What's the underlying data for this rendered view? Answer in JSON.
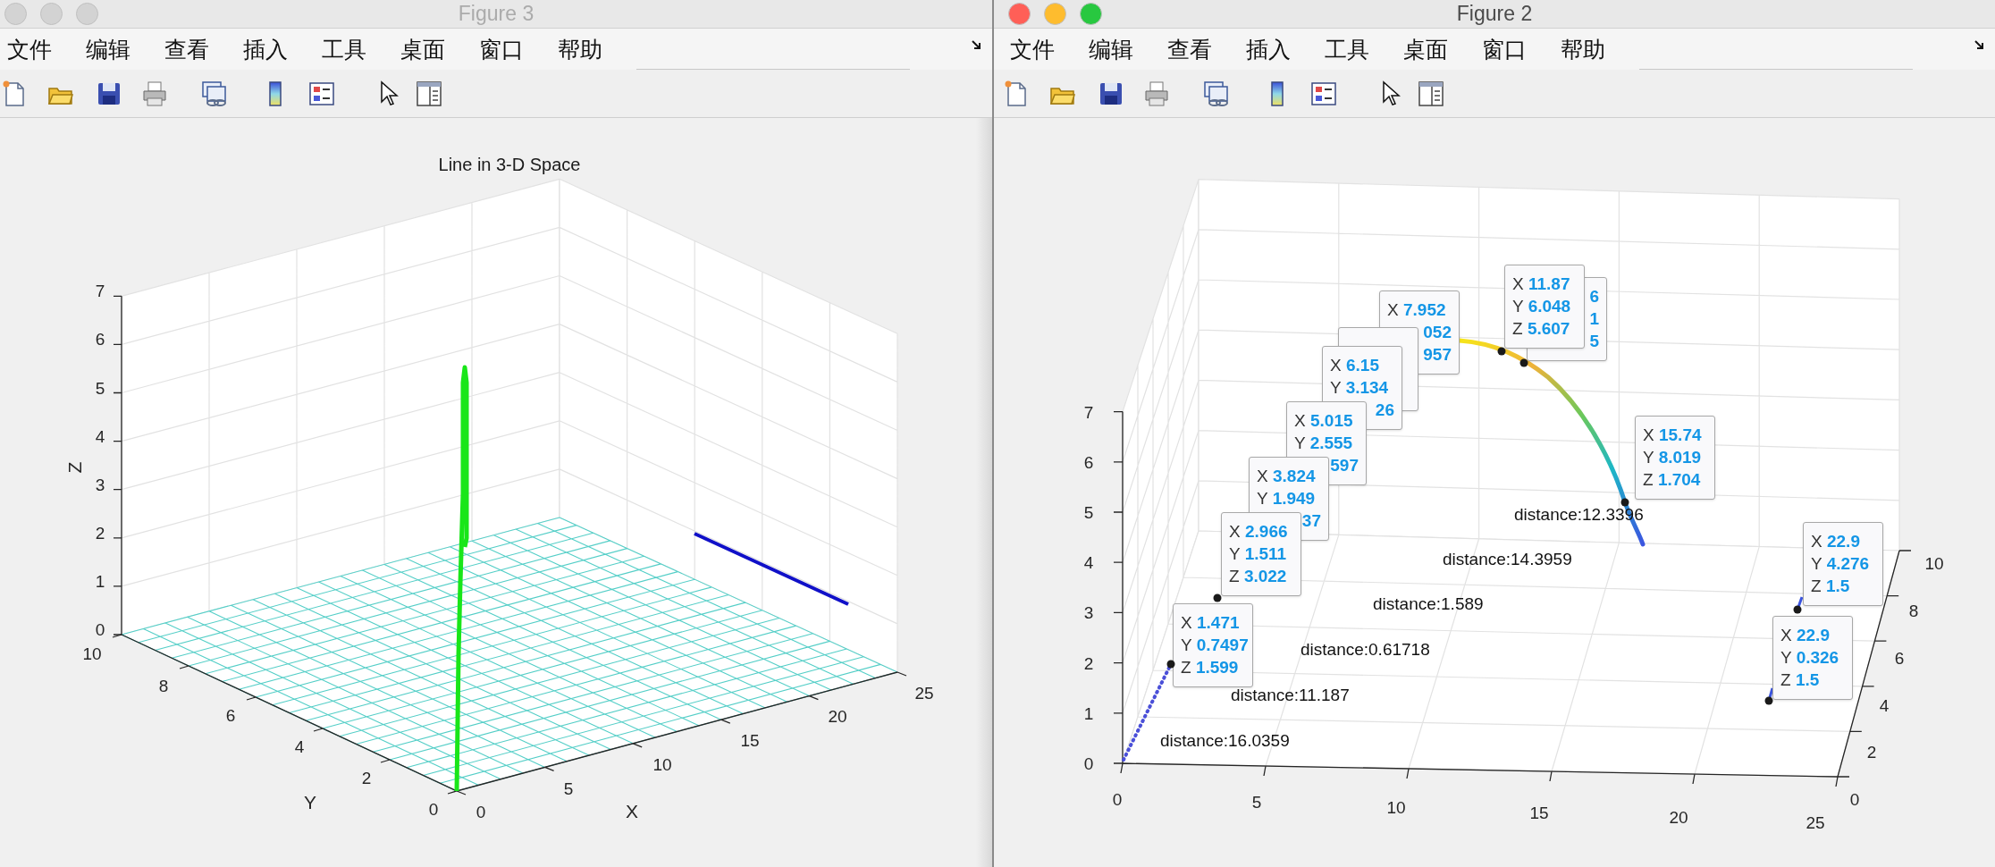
{
  "windows": [
    {
      "title": "Figure 3",
      "active": false,
      "menu": [
        "文件",
        "编辑",
        "查看",
        "插入",
        "工具",
        "桌面",
        "窗口",
        "帮助"
      ],
      "plot": {
        "kind": "lines3d",
        "title": "Line in 3-D Space",
        "xlabel": "X",
        "ylabel": "Y",
        "zlabel": "Z",
        "xticks": [
          "0",
          "5",
          "10",
          "15",
          "20",
          "25"
        ],
        "yticks": [
          "10",
          "8",
          "6",
          "4",
          "2",
          "0"
        ],
        "zticks": [
          "7",
          "6",
          "5",
          "4",
          "3",
          "2",
          "1",
          "0"
        ]
      }
    },
    {
      "title": "Figure 2",
      "active": true,
      "menu": [
        "文件",
        "编辑",
        "查看",
        "插入",
        "工具",
        "桌面",
        "窗口",
        "帮助"
      ],
      "plot": {
        "kind": "tips3d",
        "xticks": [
          "0",
          "5",
          "10",
          "15",
          "20",
          "25"
        ],
        "yticks": [
          "10",
          "8",
          "6",
          "4",
          "2",
          "0"
        ],
        "zticks": [
          "7",
          "6",
          "5",
          "4",
          "3",
          "2",
          "1",
          "0"
        ],
        "data_tips": [
          {
            "rows": [
              {
                "value": "6"
              },
              {
                "value": "1"
              },
              {
                "value": "5"
              }
            ]
          },
          {
            "rows": [
              {
                "label": "X",
                "value": "11.87"
              },
              {
                "label": "Y",
                "value": "6.048"
              },
              {
                "label": "Z",
                "value": "5.607"
              }
            ]
          },
          {
            "rows": [
              {
                "label": "X",
                "value": "7.952"
              },
              {
                "value": "052"
              },
              {
                "value": "957"
              }
            ]
          },
          {
            "rows": [
              {
                "label": "X",
                "value": "6.15"
              },
              {
                "label": "Y",
                "value": "3.134"
              },
              {
                "value": "26"
              }
            ]
          },
          {
            "rows": [
              {
                "label": "X",
                "value": "5.015"
              },
              {
                "label": "Y",
                "value": "2.555"
              },
              {
                "value": "597"
              }
            ]
          },
          {
            "rows": [
              {
                "label": "X",
                "value": "3.824"
              },
              {
                "label": "Y",
                "value": "1.949"
              },
              {
                "value": "37"
              }
            ]
          },
          {
            "rows": [
              {
                "label": "X",
                "value": "2.966"
              },
              {
                "label": "Y",
                "value": "1.511"
              },
              {
                "label": "Z",
                "value": "3.022"
              }
            ]
          },
          {
            "rows": [
              {
                "label": "X",
                "value": "1.471"
              },
              {
                "label": "Y",
                "value": "0.7497"
              },
              {
                "label": "Z",
                "value": "1.599"
              }
            ]
          },
          {
            "rows": [
              {
                "label": "X",
                "value": "15.74"
              },
              {
                "label": "Y",
                "value": "8.019"
              },
              {
                "label": "Z",
                "value": "1.704"
              }
            ]
          },
          {
            "rows": [
              {
                "label": "X",
                "value": "22.9"
              },
              {
                "label": "Y",
                "value": "4.276"
              },
              {
                "label": "Z",
                "value": "1.5"
              }
            ]
          },
          {
            "rows": [
              {
                "label": "X",
                "value": "22.9"
              },
              {
                "label": "Y",
                "value": "0.326"
              },
              {
                "label": "Z",
                "value": "1.5"
              }
            ]
          }
        ],
        "distances": [
          "distance:12.3396",
          "distance:14.3959",
          "distance:1.589",
          "distance:0.61718",
          "distance:11.187",
          "distance:16.0359"
        ]
      }
    }
  ]
}
